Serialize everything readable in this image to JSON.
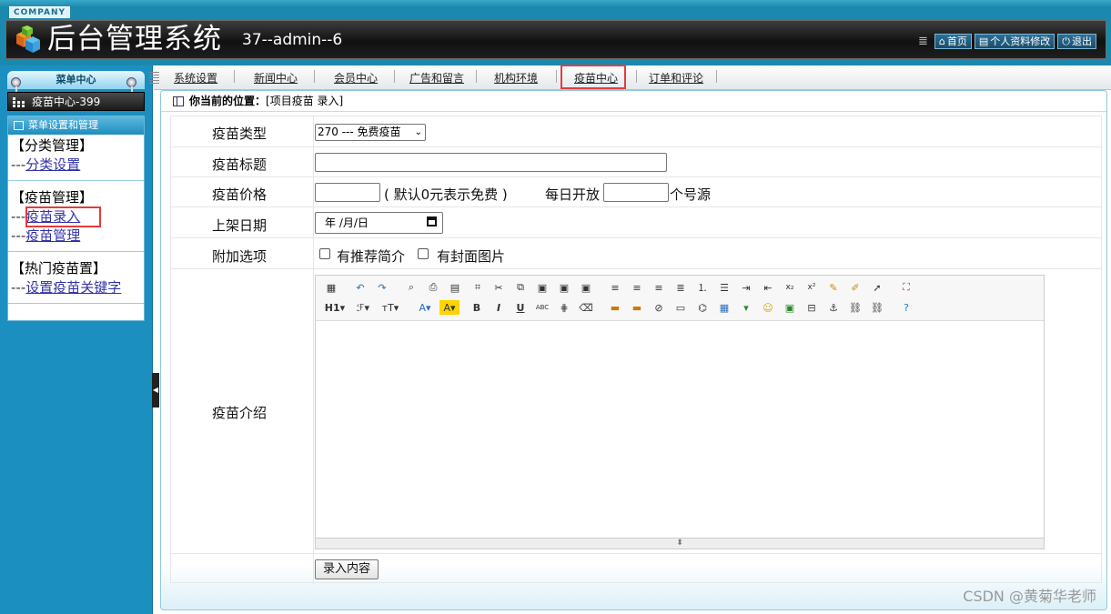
{
  "header": {
    "company": "COMPANY",
    "title": "后台管理系统",
    "user_info": "37--admin--6",
    "actions": [
      {
        "label": "首页",
        "icon": "home-icon"
      },
      {
        "label": "个人资料修改",
        "icon": "document-icon"
      },
      {
        "label": "退出",
        "icon": "power-icon"
      }
    ]
  },
  "sidebar": {
    "menu_center": "菜单中心",
    "section_title": "疫苗中心-399",
    "panel_title": "菜单设置和管理",
    "groups": [
      {
        "title": "【分类管理】",
        "links": [
          {
            "prefix": "---",
            "label": "分类设置"
          }
        ]
      },
      {
        "title": "【疫苗管理】",
        "links": [
          {
            "prefix": "---",
            "label": "疫苗录入"
          },
          {
            "prefix": "---",
            "label": "疫苗管理"
          }
        ]
      },
      {
        "title": "【热门疫苗置】",
        "links": [
          {
            "prefix": "---",
            "label": "设置疫苗关键字"
          }
        ]
      }
    ]
  },
  "tabs": [
    {
      "label": "系统设置"
    },
    {
      "label": "新闻中心"
    },
    {
      "label": "会员中心"
    },
    {
      "label": "广告和留言"
    },
    {
      "label": "机构环境"
    },
    {
      "label": "疫苗中心",
      "active": true
    },
    {
      "label": "订单和评论"
    }
  ],
  "location": {
    "prefix": "你当前的位置：",
    "path": "[项目疫苗 录入]"
  },
  "form": {
    "type_label": "疫苗类型",
    "type_value": "270 --- 免费疫苗",
    "title_label": "疫苗标题",
    "price_label": "疫苗价格",
    "price_hint": "( 默认0元表示免费 )",
    "daily_prefix": "每日开放",
    "daily_suffix": "个号源",
    "date_label": "上架日期",
    "date_placeholder": "年 /月/日",
    "options_label": "附加选项",
    "option1": "有推荐简介",
    "option2": "有封面图片",
    "intro_label": "疫苗介绍",
    "submit_label": "录入内容"
  },
  "watermark": "CSDN @黄菊华老师"
}
